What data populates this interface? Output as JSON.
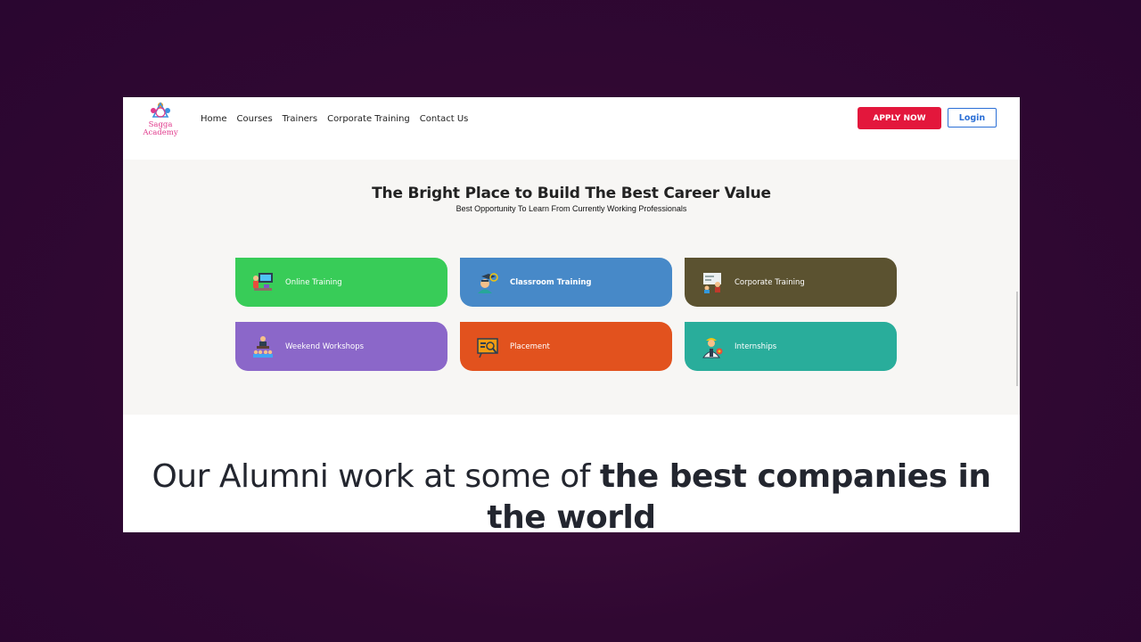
{
  "brand": {
    "logo_text": "Sagga Academy"
  },
  "nav": {
    "items": [
      "Home",
      "Courses",
      "Trainers",
      "Corporate Training",
      "Contact Us"
    ]
  },
  "header": {
    "apply_label": "APPLY NOW",
    "login_label": "Login"
  },
  "hero": {
    "title": "The Bright Place to Build The Best Career Value",
    "subtitle": "Best Opportunity To Learn From Currently Working Professionals"
  },
  "cards": [
    {
      "label": "Online Training",
      "color": "#38cc58",
      "icon": "online-training-icon"
    },
    {
      "label": "Classroom Training",
      "color": "#4789c8",
      "icon": "classroom-training-icon"
    },
    {
      "label": "Corporate Training",
      "color": "#5b5230",
      "icon": "corporate-training-icon"
    },
    {
      "label": "Weekend Workshops",
      "color": "#8b67c9",
      "icon": "weekend-workshops-icon"
    },
    {
      "label": "Placement",
      "color": "#e2521e",
      "icon": "placement-icon"
    },
    {
      "label": "Internships",
      "color": "#29ad9b",
      "icon": "internships-icon"
    }
  ],
  "alumni": {
    "text_plain": "Our Alumni work at some of ",
    "text_bold": "the best companies in the world"
  },
  "colors": {
    "background": "#300832",
    "apply": "#e3173c",
    "login": "#2b6fd6"
  }
}
